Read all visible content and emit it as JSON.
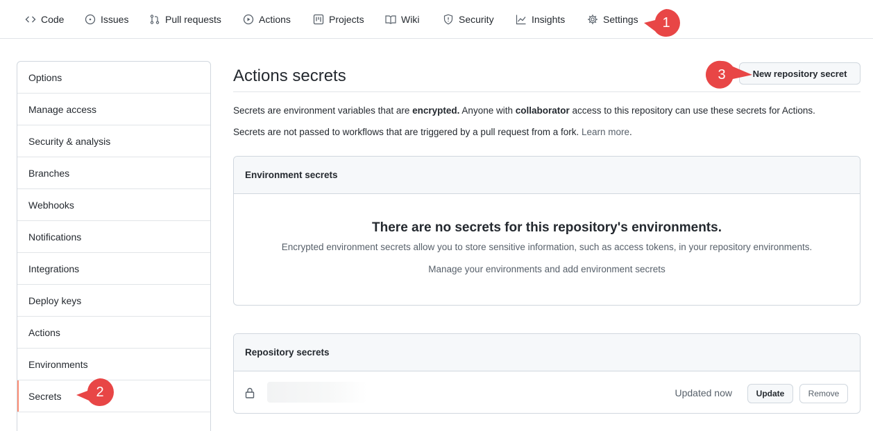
{
  "nav": {
    "tabs": [
      {
        "label": "Code",
        "icon": "code-icon"
      },
      {
        "label": "Issues",
        "icon": "issue-icon"
      },
      {
        "label": "Pull requests",
        "icon": "pull-request-icon"
      },
      {
        "label": "Actions",
        "icon": "play-icon"
      },
      {
        "label": "Projects",
        "icon": "project-icon"
      },
      {
        "label": "Wiki",
        "icon": "book-icon"
      },
      {
        "label": "Security",
        "icon": "shield-icon"
      },
      {
        "label": "Insights",
        "icon": "graph-icon"
      },
      {
        "label": "Settings",
        "icon": "gear-icon"
      }
    ]
  },
  "sidebar": {
    "items": [
      {
        "label": "Options"
      },
      {
        "label": "Manage access"
      },
      {
        "label": "Security & analysis"
      },
      {
        "label": "Branches"
      },
      {
        "label": "Webhooks"
      },
      {
        "label": "Notifications"
      },
      {
        "label": "Integrations"
      },
      {
        "label": "Deploy keys"
      },
      {
        "label": "Actions"
      },
      {
        "label": "Environments"
      },
      {
        "label": "Secrets"
      }
    ],
    "selected": "Secrets"
  },
  "main": {
    "title": "Actions secrets",
    "new_secret_button": "New repository secret",
    "desc1": {
      "part1": "Secrets are environment variables that are ",
      "bold1": "encrypted.",
      "part2": " Anyone with ",
      "bold2": "collaborator",
      "part3": " access to this repository can use these secrets for Actions."
    },
    "desc2": {
      "text": "Secrets are not passed to workflows that are triggered by a pull request from a fork. ",
      "link": "Learn more",
      "end": "."
    },
    "env_secrets": {
      "header": "Environment secrets",
      "blank_title": "There are no secrets for this repository's environments.",
      "blank_text": "Encrypted environment secrets allow you to store sensitive information, such as access tokens, in your repository environments.",
      "manage_text": "Manage your environments and add environment secrets"
    },
    "repo_secrets": {
      "header": "Repository secrets",
      "status": "Updated now",
      "update_button": "Update",
      "remove_button": "Remove"
    }
  },
  "callouts": [
    "1",
    "2",
    "3"
  ],
  "colors": {
    "callout_red": "#e84646",
    "selected_marker": "#fd8c73"
  }
}
